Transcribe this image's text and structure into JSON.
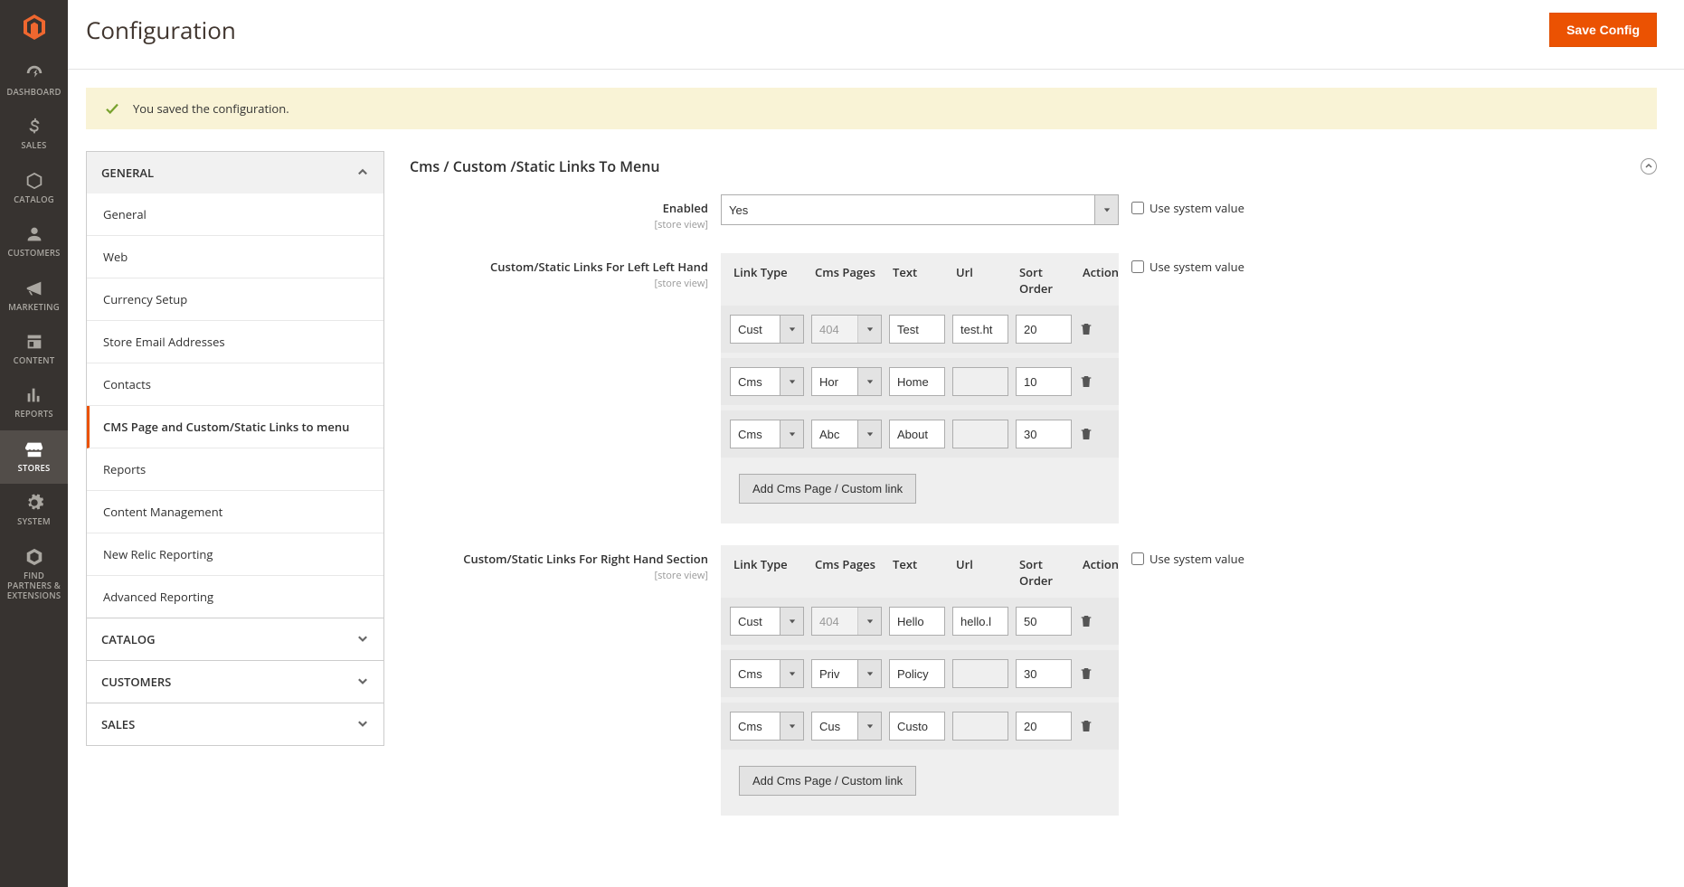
{
  "header": {
    "title": "Configuration",
    "save_btn": "Save Config"
  },
  "message": {
    "text": "You saved the configuration."
  },
  "nav": {
    "items": [
      {
        "label": "DASHBOARD",
        "icon": "dashboard"
      },
      {
        "label": "SALES",
        "icon": "dollar"
      },
      {
        "label": "CATALOG",
        "icon": "catalog"
      },
      {
        "label": "CUSTOMERS",
        "icon": "customers"
      },
      {
        "label": "MARKETING",
        "icon": "marketing"
      },
      {
        "label": "CONTENT",
        "icon": "content"
      },
      {
        "label": "REPORTS",
        "icon": "reports"
      },
      {
        "label": "STORES",
        "icon": "stores"
      },
      {
        "label": "SYSTEM",
        "icon": "system"
      },
      {
        "label": "FIND PARTNERS & EXTENSIONS",
        "icon": "partners"
      }
    ],
    "active": 7
  },
  "sidebar": {
    "sections": [
      {
        "title": "GENERAL",
        "open": true,
        "items": [
          "General",
          "Web",
          "Currency Setup",
          "Store Email Addresses",
          "Contacts",
          "CMS Page and Custom/Static Links to menu",
          "Reports",
          "Content Management",
          "New Relic Reporting",
          "Advanced Reporting"
        ],
        "active": 5
      },
      {
        "title": "CATALOG",
        "open": false
      },
      {
        "title": "CUSTOMERS",
        "open": false
      },
      {
        "title": "SALES",
        "open": false
      }
    ]
  },
  "panel": {
    "title": "Cms / Custom /Static Links To Menu",
    "enabled": {
      "label": "Enabled",
      "scope": "[store view]",
      "value": "Yes"
    },
    "left": {
      "label": "Custom/Static Links For Left Left Hand",
      "scope": "[store view]",
      "headers": {
        "type": "Link Type",
        "cms": "Cms Pages",
        "text": "Text",
        "url": "Url",
        "sort": "Sort Order",
        "action": "Action"
      },
      "rows": [
        {
          "type": "Cust",
          "cms": "404",
          "cms_disabled": true,
          "text": "Test",
          "url": "test.ht",
          "url_disabled": false,
          "sort": "20"
        },
        {
          "type": "Cms",
          "cms": "Hor",
          "cms_disabled": false,
          "text": "Home",
          "url": "",
          "url_disabled": true,
          "sort": "10"
        },
        {
          "type": "Cms",
          "cms": "Abc",
          "cms_disabled": false,
          "text": "About",
          "url": "",
          "url_disabled": true,
          "sort": "30"
        }
      ],
      "add_btn": "Add Cms Page / Custom link"
    },
    "right": {
      "label": "Custom/Static Links For Right Hand Section",
      "scope": "[store view]",
      "headers": {
        "type": "Link Type",
        "cms": "Cms Pages",
        "text": "Text",
        "url": "Url",
        "sort": "Sort Order",
        "action": "Action"
      },
      "rows": [
        {
          "type": "Cust",
          "cms": "404",
          "cms_disabled": true,
          "text": "Hello",
          "url": "hello.l",
          "url_disabled": false,
          "sort": "50"
        },
        {
          "type": "Cms",
          "cms": "Priv",
          "cms_disabled": false,
          "text": "Policy",
          "url": "",
          "url_disabled": true,
          "sort": "30"
        },
        {
          "type": "Cms",
          "cms": "Cus",
          "cms_disabled": false,
          "text": "Custo",
          "url": "",
          "url_disabled": true,
          "sort": "20"
        }
      ],
      "add_btn": "Add Cms Page / Custom link"
    },
    "sys_label": "Use system value"
  }
}
